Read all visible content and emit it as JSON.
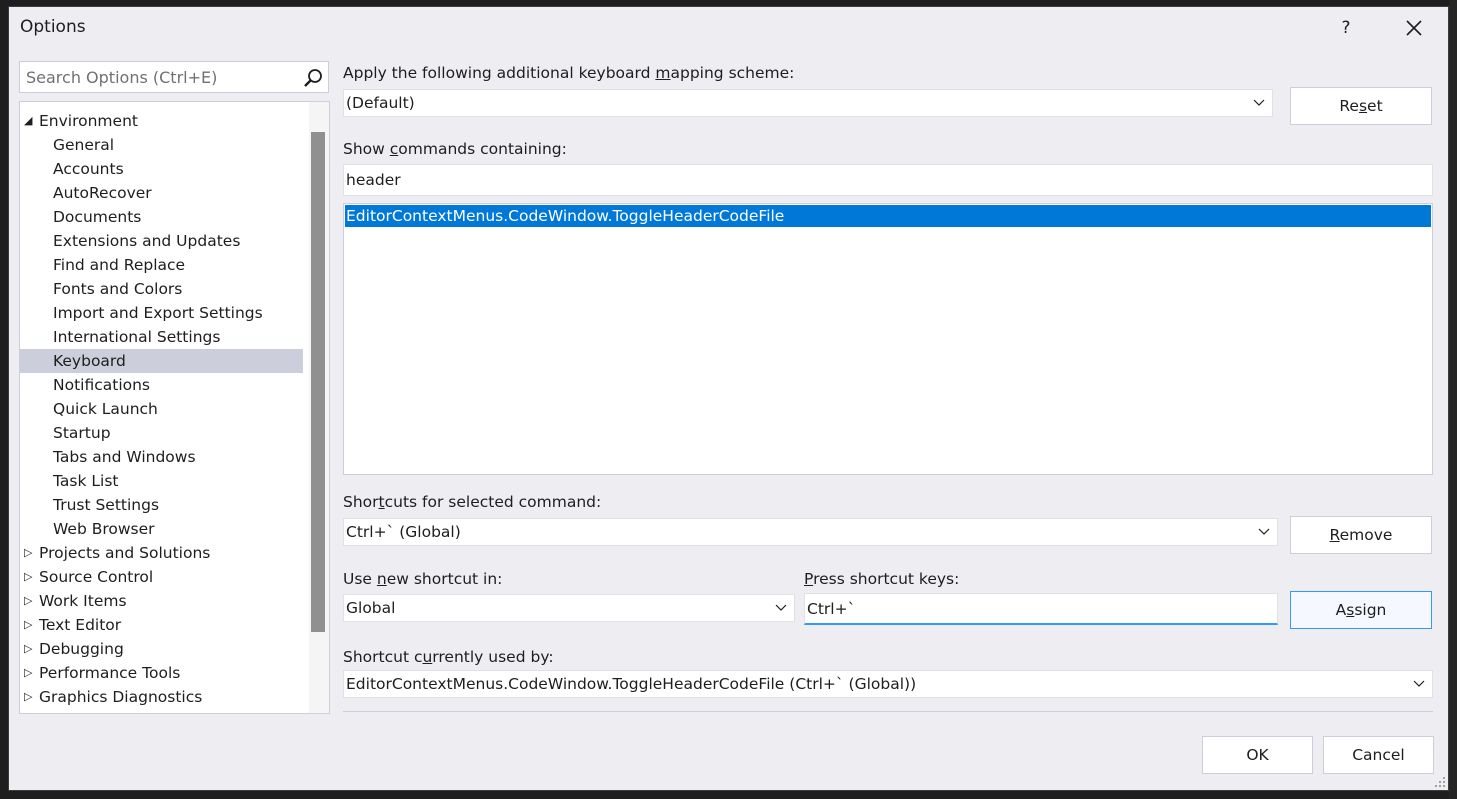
{
  "dialog": {
    "title": "Options",
    "help_label": "?",
    "search_placeholder": "Search Options (Ctrl+E)"
  },
  "tree": {
    "items": [
      {
        "label": "Environment",
        "expander": "expanded"
      },
      {
        "label": "General"
      },
      {
        "label": "Accounts"
      },
      {
        "label": "AutoRecover"
      },
      {
        "label": "Documents"
      },
      {
        "label": "Extensions and Updates"
      },
      {
        "label": "Find and Replace"
      },
      {
        "label": "Fonts and Colors"
      },
      {
        "label": "Import and Export Settings"
      },
      {
        "label": "International Settings"
      },
      {
        "label": "Keyboard",
        "selected": true
      },
      {
        "label": "Notifications"
      },
      {
        "label": "Quick Launch"
      },
      {
        "label": "Startup"
      },
      {
        "label": "Tabs and Windows"
      },
      {
        "label": "Task List"
      },
      {
        "label": "Trust Settings"
      },
      {
        "label": "Web Browser"
      },
      {
        "label": "Projects and Solutions",
        "expander": "collapsed"
      },
      {
        "label": "Source Control",
        "expander": "collapsed"
      },
      {
        "label": "Work Items",
        "expander": "collapsed"
      },
      {
        "label": "Text Editor",
        "expander": "collapsed"
      },
      {
        "label": "Debugging",
        "expander": "collapsed"
      },
      {
        "label": "Performance Tools",
        "expander": "collapsed"
      },
      {
        "label": "Graphics Diagnostics",
        "expander": "collapsed"
      }
    ]
  },
  "keyboard": {
    "mapping_label_pre": "Apply the following additional keyboard ",
    "mapping_label_key": "m",
    "mapping_label_post": "apping scheme:",
    "mapping_value": "(Default)",
    "reset_pre": "Re",
    "reset_key": "s",
    "reset_post": "et",
    "show_label_pre": "Show ",
    "show_label_key": "c",
    "show_label_post": "ommands containing:",
    "show_value": "header",
    "commands": [
      "EditorContextMenus.CodeWindow.ToggleHeaderCodeFile"
    ],
    "shortcuts_label_pre": "Shor",
    "shortcuts_label_key": "t",
    "shortcuts_label_post": "cuts for selected command:",
    "shortcuts_value": "Ctrl+` (Global)",
    "remove_key": "R",
    "remove_post": "emove",
    "use_label_pre": "Use ",
    "use_label_key": "n",
    "use_label_post": "ew shortcut in:",
    "use_value": "Global",
    "press_label_key": "P",
    "press_label_post": "ress shortcut keys:",
    "press_value": "Ctrl+`",
    "assign_pre": "A",
    "assign_key": "s",
    "assign_post": "sign",
    "used_by_label_pre": "Shortcut c",
    "used_by_label_key": "u",
    "used_by_label_post": "rrently used by:",
    "used_by_value": "EditorContextMenus.CodeWindow.ToggleHeaderCodeFile (Ctrl+` (Global))"
  },
  "footer": {
    "ok_label": "OK",
    "cancel_label": "Cancel"
  }
}
